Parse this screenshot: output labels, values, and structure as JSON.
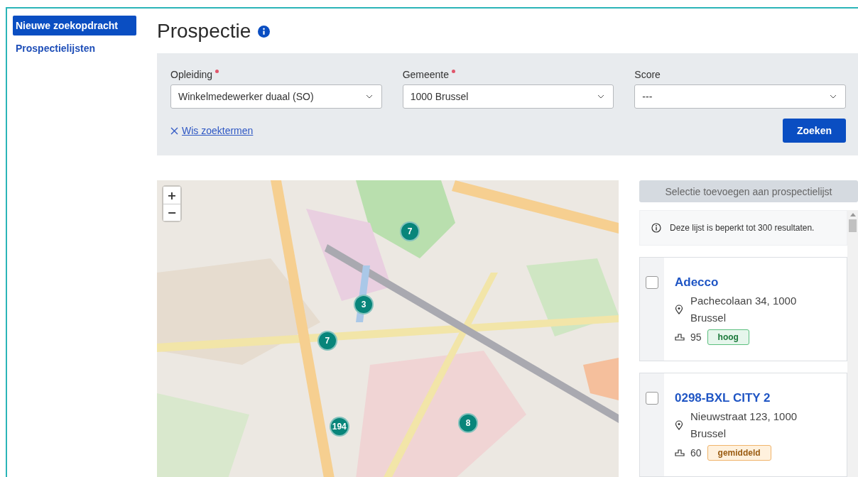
{
  "sidebar": {
    "items": [
      {
        "label": "Nieuwe zoekopdracht",
        "selected": true
      },
      {
        "label": "Prospectielijsten",
        "selected": false
      }
    ]
  },
  "page": {
    "title": "Prospectie"
  },
  "filters": {
    "fields": [
      {
        "label": "Opleiding",
        "required": true,
        "value": "Winkelmedewerker duaal (SO)"
      },
      {
        "label": "Gemeente",
        "required": true,
        "value": "1000 Brussel"
      },
      {
        "label": "Score",
        "required": false,
        "value": "---"
      }
    ],
    "clear_link": "Wis zoektermen",
    "search_button": "Zoeken"
  },
  "map": {
    "zoom_in": "+",
    "zoom_out": "−",
    "markers": [
      {
        "count": "7"
      },
      {
        "count": "3"
      },
      {
        "count": "7"
      },
      {
        "count": "194"
      },
      {
        "count": "8"
      }
    ]
  },
  "results": {
    "add_button": "Selectie toevoegen aan prospectielijst",
    "add_disabled": true,
    "notice": "Deze lijst is beperkt tot 300 resultaten.",
    "items": [
      {
        "name": "Adecco",
        "address": "Pachecolaan 34, 1000 Brussel",
        "score": "95",
        "rating": "hoog",
        "kind": "high",
        "checked": false
      },
      {
        "name": "0298-BXL CITY 2",
        "address": "Nieuwstraat 123, 1000 Brussel",
        "score": "60",
        "rating": "gemiddeld",
        "kind": "medium",
        "checked": false
      }
    ]
  }
}
